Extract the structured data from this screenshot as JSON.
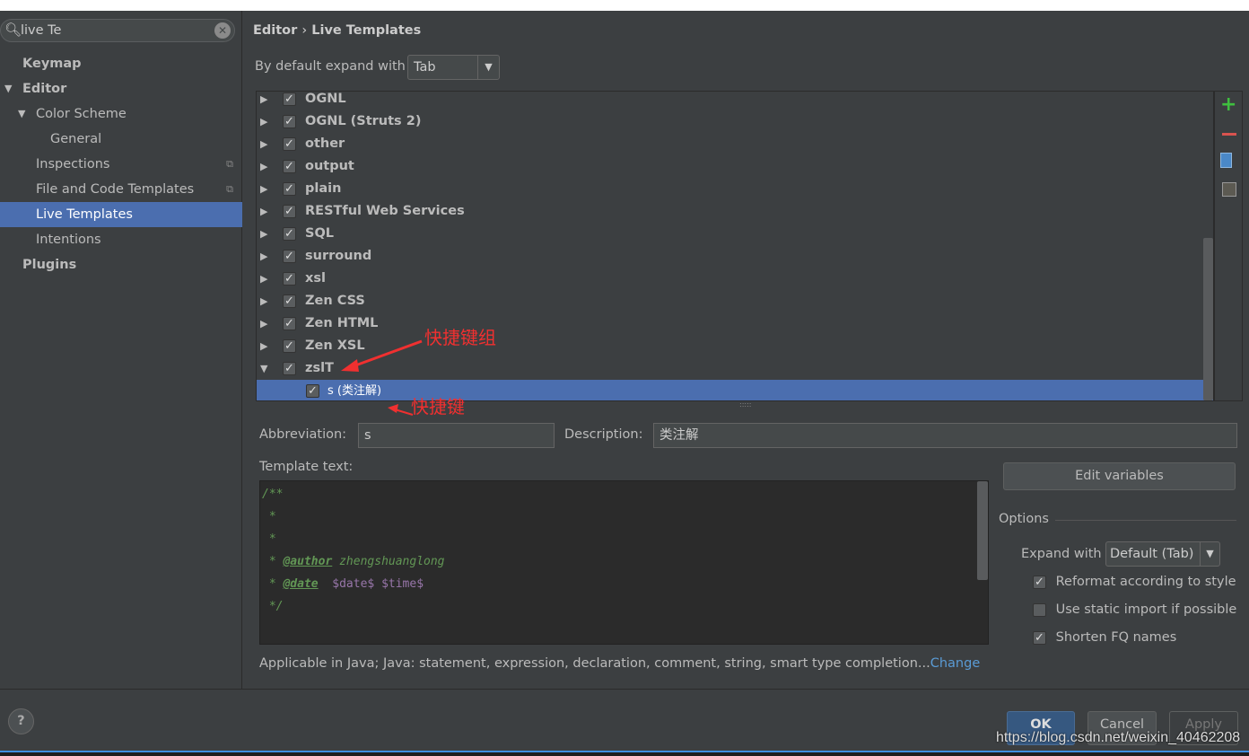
{
  "search": {
    "value": "live Te"
  },
  "sidebar": {
    "items": [
      {
        "label": "Keymap",
        "level": 0,
        "bold": true
      },
      {
        "label": "Editor",
        "level": 0,
        "bold": true,
        "expanded": true
      },
      {
        "label": "Color Scheme",
        "level": 1,
        "expanded": true
      },
      {
        "label": "General",
        "level": 2
      },
      {
        "label": "Inspections",
        "level": 1,
        "project_icon": true
      },
      {
        "label": "File and Code Templates",
        "level": 1,
        "project_icon": true
      },
      {
        "label": "Live Templates",
        "level": 1,
        "selected": true
      },
      {
        "label": "Intentions",
        "level": 1
      },
      {
        "label": "Plugins",
        "level": 0,
        "bold": true
      }
    ]
  },
  "header": {
    "breadcrumb_parent": "Editor",
    "separator": "›",
    "breadcrumb_current": "Live Templates"
  },
  "expand": {
    "label": "By default expand with",
    "value": "Tab"
  },
  "tree": {
    "groups": [
      {
        "label": "OGNL",
        "checked": true
      },
      {
        "label": "OGNL (Struts 2)",
        "checked": true
      },
      {
        "label": "other",
        "checked": true
      },
      {
        "label": "output",
        "checked": true
      },
      {
        "label": "plain",
        "checked": true
      },
      {
        "label": "RESTful Web Services",
        "checked": true
      },
      {
        "label": "SQL",
        "checked": true
      },
      {
        "label": "surround",
        "checked": true
      },
      {
        "label": "xsl",
        "checked": true
      },
      {
        "label": "Zen CSS",
        "checked": true
      },
      {
        "label": "Zen HTML",
        "checked": true
      },
      {
        "label": "Zen XSL",
        "checked": true
      },
      {
        "label": "zslT",
        "checked": true,
        "expanded": true
      }
    ],
    "child": {
      "label": "s (类注解)",
      "checked": true,
      "selected": true
    }
  },
  "annotations": {
    "group": "快捷键组",
    "key": "快捷键",
    "color": "#f03030"
  },
  "form": {
    "abbreviation_label": "Abbreviation:",
    "abbreviation": "s",
    "description_label": "Description:",
    "description": "类注解",
    "template_label": "Template text:"
  },
  "code": {
    "l1": "/**",
    "l2": " *",
    "l3": " *",
    "l4_star": " * ",
    "l4_tag": "@author",
    "l4_text": " zhengshuanglong",
    "l5_star": " * ",
    "l5_tag": "@date",
    "l5_vars": "  $date$ $time$",
    "l6": " */"
  },
  "options": {
    "edit_variables": "Edit variables",
    "title": "Options",
    "expand_label": "Expand with",
    "expand_value": "Default (Tab)",
    "checks": [
      {
        "label": "Reformat according to style",
        "checked": true
      },
      {
        "label": "Use static import if possible",
        "checked": false
      },
      {
        "label": "Shorten FQ names",
        "checked": true
      }
    ]
  },
  "applicable": {
    "text": "Applicable in Java; Java: statement, expression, declaration, comment, string, smart type completion...",
    "link": "Change"
  },
  "footer": {
    "help": "?",
    "ok": "OK",
    "cancel": "Cancel",
    "apply": "Apply",
    "watermark": "https://blog.csdn.net/weixin_40462208"
  },
  "colors": {
    "selection": "#4b6eaf",
    "add": "#3fbf3f",
    "remove": "#d9534f",
    "link": "#5a9bd5"
  }
}
